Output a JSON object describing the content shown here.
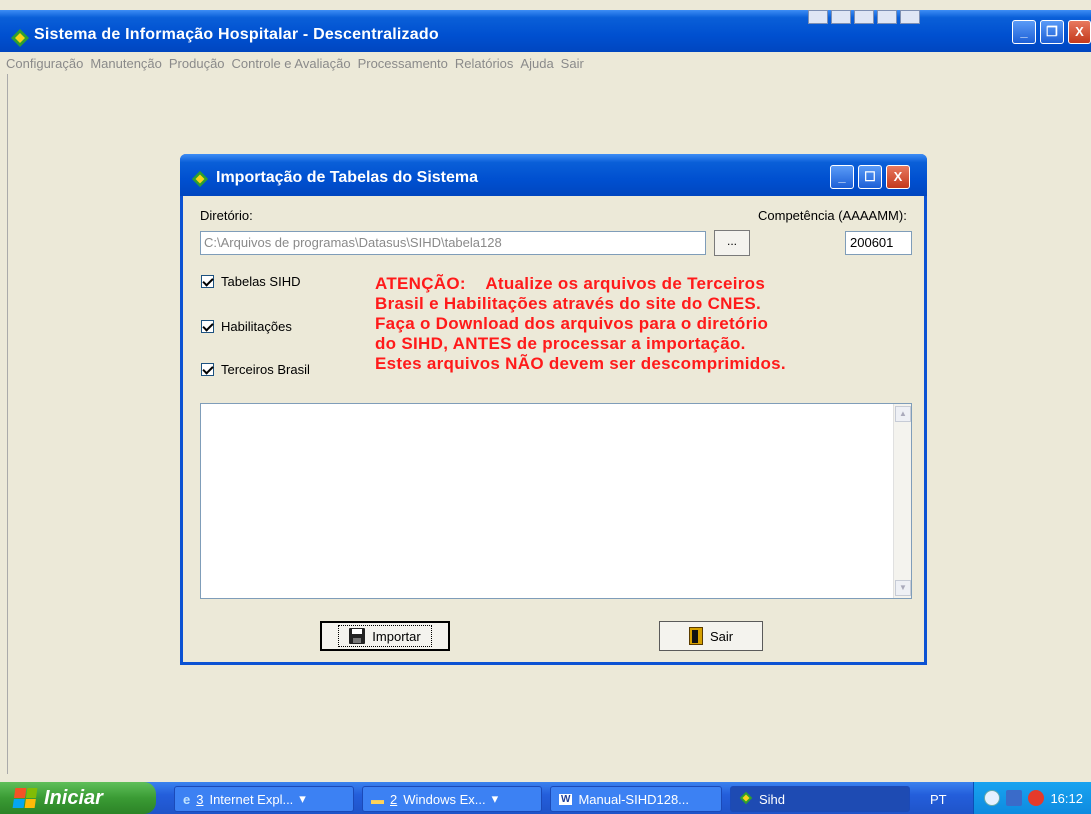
{
  "app": {
    "title": "Sistema de Informação Hospitalar - Descentralizado",
    "menu": [
      "Configuração",
      "Manutenção",
      "Produção",
      "Controle e Avaliação",
      "Processamento",
      "Relatórios",
      "Ajuda",
      "Sair"
    ]
  },
  "dialog": {
    "title": "Importação de Tabelas do Sistema",
    "directory_label": "Diretório:",
    "directory_value": "C:\\Arquivos de programas\\Datasus\\SIHD\\tabela128",
    "browse_label": "...",
    "competence_label": "Competência (AAAAMM):",
    "competence_value": "200601",
    "checkboxes": [
      {
        "label": "Tabelas SIHD",
        "checked": true
      },
      {
        "label": "Habilitações",
        "checked": true
      },
      {
        "label": "Terceiros Brasil",
        "checked": true
      }
    ],
    "warning_lines": [
      "ATENÇÃO:    Atualize os arquivos de Terceiros",
      "Brasil e Habilitações através do site do CNES.",
      "Faça o Download dos arquivos para o diretório",
      "do SIHD, ANTES de processar a importação.",
      "Estes arquivos NÃO devem ser descomprimidos."
    ],
    "import_button": "Importar",
    "exit_button": "Sair",
    "warning_color": "#ff1a1a"
  },
  "taskbar": {
    "start_label": "Iniciar",
    "tasks": [
      {
        "num": "3",
        "label": "Internet Expl..."
      },
      {
        "num": "2",
        "label": "Windows Ex..."
      },
      {
        "num": "",
        "label": "Manual-SIHD128..."
      },
      {
        "num": "",
        "label": "Sihd"
      }
    ],
    "language": "PT",
    "clock": "16:12"
  }
}
